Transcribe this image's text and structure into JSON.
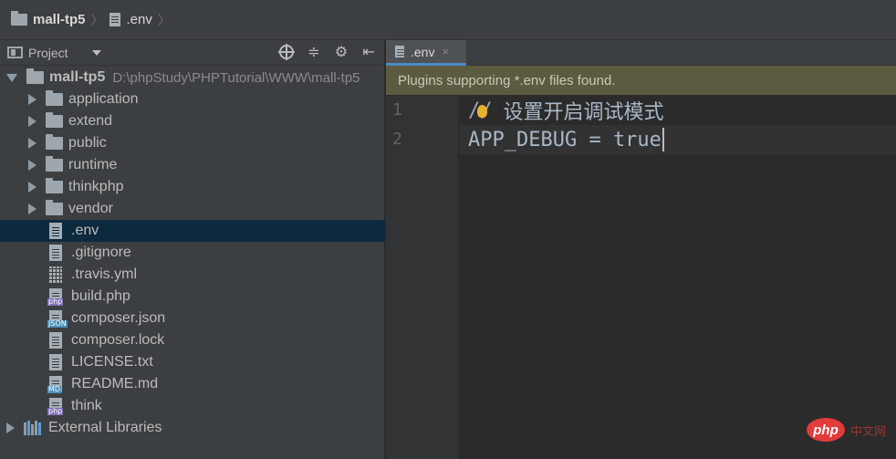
{
  "breadcrumb": {
    "project": "mall-tp5",
    "file": ".env"
  },
  "sidebar": {
    "view_label": "Project",
    "root": {
      "name": "mall-tp5",
      "path": "D:\\phpStudy\\PHPTutorial\\WWW\\mall-tp5"
    },
    "folders": [
      "application",
      "extend",
      "public",
      "runtime",
      "thinkphp",
      "vendor"
    ],
    "files": [
      {
        "name": ".env",
        "icon": "text-file-icon"
      },
      {
        "name": ".gitignore",
        "icon": "text-file-icon"
      },
      {
        "name": ".travis.yml",
        "icon": "yaml-file-icon"
      },
      {
        "name": "build.php",
        "icon": "php-file-icon",
        "tag": "php"
      },
      {
        "name": "composer.json",
        "icon": "json-file-icon",
        "tag": "JSON"
      },
      {
        "name": "composer.lock",
        "icon": "text-file-icon"
      },
      {
        "name": "LICENSE.txt",
        "icon": "text-file-icon"
      },
      {
        "name": "README.md",
        "icon": "markdown-file-icon",
        "tag": "MD"
      },
      {
        "name": "think",
        "icon": "php-file-icon",
        "tag": "php"
      }
    ],
    "external": "External Libraries"
  },
  "editor": {
    "tab_label": ".env",
    "tab_close": "×",
    "banner": "Plugins supporting *.env files found.",
    "lines": [
      {
        "number": "1",
        "mark": "//",
        "text": "设置开启调试模式"
      },
      {
        "number": "2",
        "text": "APP_DEBUG = true"
      }
    ]
  },
  "watermark": {
    "logo": "php",
    "text": "中文网"
  },
  "colors": {
    "selection": "#0d293e",
    "banner": "#5c5b40",
    "tab_underline": "#4a88c7"
  }
}
